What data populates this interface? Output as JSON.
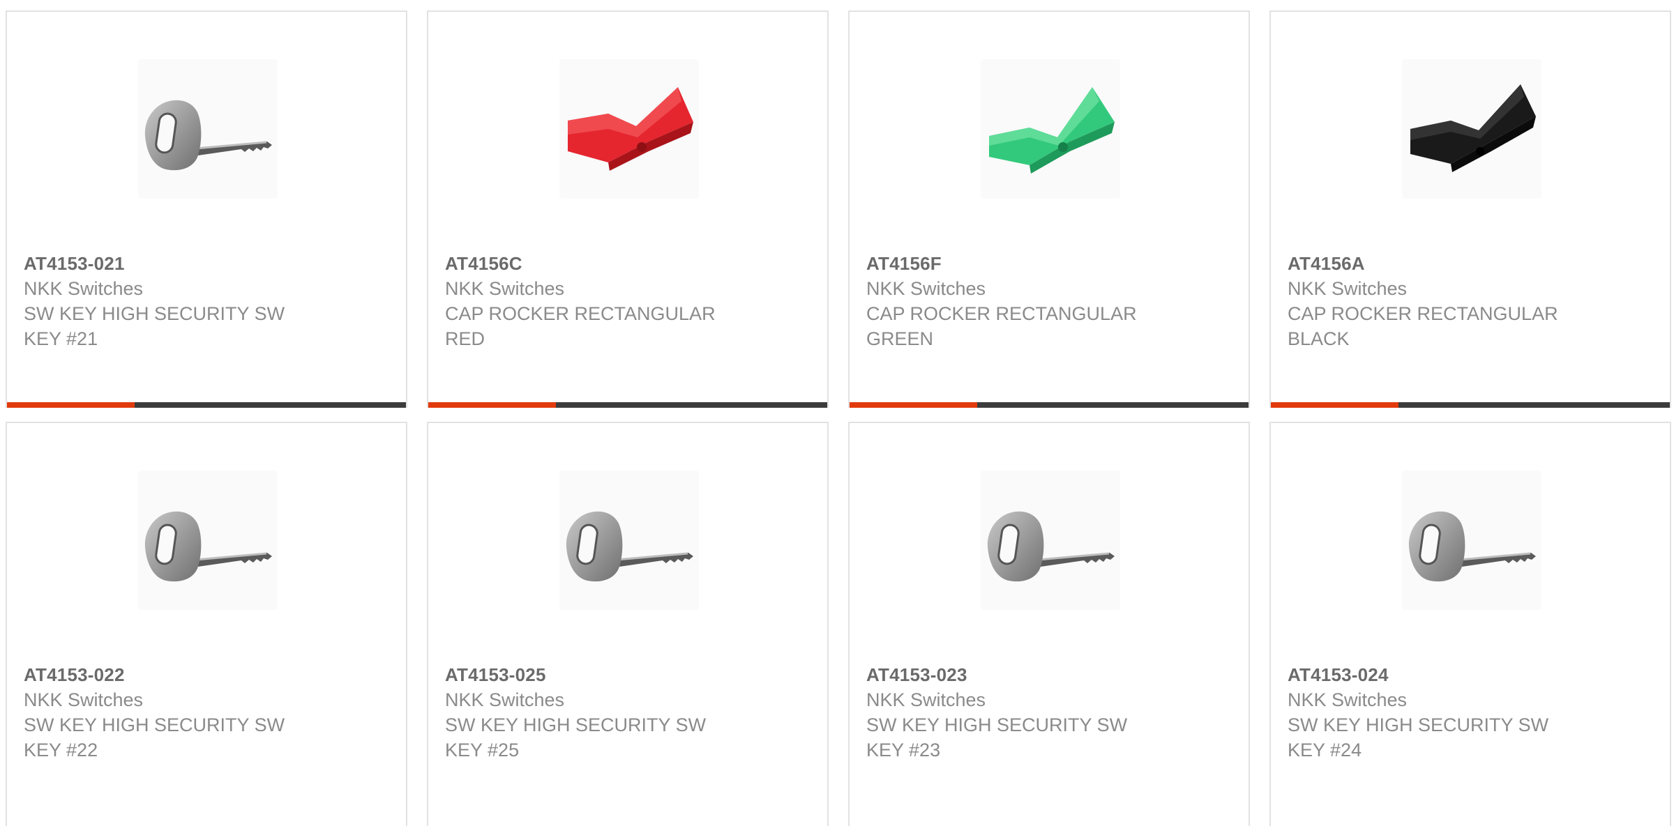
{
  "colors": {
    "accent": "#e13a0d",
    "bar_dark": "#3c3c3c",
    "key_metal": "#9a9a9a",
    "cap_red": "#e5262f",
    "cap_green": "#33c97c",
    "cap_black": "#1a1a1a"
  },
  "products": [
    {
      "part_number": "AT4153-021",
      "manufacturer": "NKK Switches",
      "description": "SW KEY HIGH SECURITY SW KEY #21",
      "image_icon": "key-icon"
    },
    {
      "part_number": "AT4156C",
      "manufacturer": "NKK Switches",
      "description": "CAP ROCKER RECTANGULAR RED",
      "image_icon": "rocker-cap-red-icon"
    },
    {
      "part_number": "AT4156F",
      "manufacturer": "NKK Switches",
      "description": "CAP ROCKER RECTANGULAR GREEN",
      "image_icon": "rocker-cap-green-icon"
    },
    {
      "part_number": "AT4156A",
      "manufacturer": "NKK Switches",
      "description": "CAP ROCKER RECTANGULAR BLACK",
      "image_icon": "rocker-cap-black-icon"
    },
    {
      "part_number": "AT4153-022",
      "manufacturer": "NKK Switches",
      "description": "SW KEY HIGH SECURITY SW KEY #22",
      "image_icon": "key-icon"
    },
    {
      "part_number": "AT4153-025",
      "manufacturer": "NKK Switches",
      "description": "SW KEY HIGH SECURITY SW KEY #25",
      "image_icon": "key-icon"
    },
    {
      "part_number": "AT4153-023",
      "manufacturer": "NKK Switches",
      "description": "SW KEY HIGH SECURITY SW KEY #23",
      "image_icon": "key-icon"
    },
    {
      "part_number": "AT4153-024",
      "manufacturer": "NKK Switches",
      "description": "SW KEY HIGH SECURITY SW KEY #24",
      "image_icon": "key-icon"
    }
  ]
}
